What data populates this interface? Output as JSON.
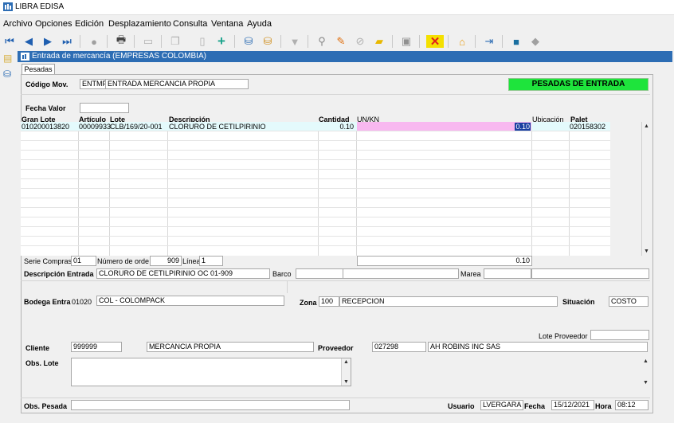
{
  "window": {
    "title": "LIBRA EDISA"
  },
  "menu": [
    "Archivo",
    "Opciones",
    "Edición",
    "Desplazamiento",
    "Consulta",
    "Ventana",
    "Ayuda"
  ],
  "form": {
    "title": "Entrada de mercancía (EMPRESAS COLOMBIA)",
    "tab": "Pesadas"
  },
  "header": {
    "codigo_mov_label": "Código Mov.",
    "codigo_mov_code": "ENTMP",
    "codigo_mov_desc": "ENTRADA MERCANCIA PROPIA",
    "banner": "PESADAS DE ENTRADA",
    "fecha_valor_label": "Fecha Valor",
    "fecha_valor": ""
  },
  "grid": {
    "columns": {
      "gran_lote": "Gran Lote",
      "articulo": "Artículo",
      "lote": "Lote",
      "descripcion": "Descripción",
      "cantidad": "Cantidad",
      "unkn": "UN/KN",
      "ubicacion": "Ubicación",
      "palet": "Palet"
    },
    "rows": [
      {
        "gran_lote": "010200013820",
        "articulo": "00009933",
        "lote": "CLB/169/20-001",
        "descripcion": "CLORURO DE CETILPIRINIO",
        "cantidad": "0.10",
        "unkn": "0.10",
        "ubicacion": "",
        "palet": "020158302"
      }
    ]
  },
  "detail": {
    "serie_compras_label": "Serie Compras",
    "serie_compras": "01",
    "numero_orden_label": "Número de orde",
    "numero_orden": "909",
    "linea_label": "Línea",
    "linea": "1",
    "total": "0.10",
    "descripcion_entrada_label": "Descripción Entrada",
    "descripcion_entrada": "CLORURO DE CETILPIRINIO OC 01-909",
    "barco_label": "Barco",
    "barco": "",
    "barco2": "",
    "marea_label": "Marea",
    "marea": "",
    "marea2": "",
    "bodega_label": "Bodega Entra",
    "bodega_code": "01020",
    "bodega_desc": "COL - COLOMPACK",
    "zona_label": "Zona",
    "zona_code": "100",
    "zona_desc": "RECEPCION",
    "situacion_label": "Situación",
    "situacion": "COSTO",
    "lote_proveedor_label": "Lote Proveedor",
    "lote_proveedor": "",
    "cliente_label": "Cliente",
    "cliente_code": "999999",
    "cliente_desc": "MERCANCIA PROPIA",
    "proveedor_label": "Proveedor",
    "proveedor_code": "027298",
    "proveedor_desc": "AH ROBINS INC SAS",
    "obs_lote_label": "Obs. Lote",
    "obs_lote": "",
    "obs_pesada_label": "Obs. Pesada",
    "obs_pesada": "",
    "usuario_label": "Usuario",
    "usuario": "LVERGARA",
    "fecha_label": "Fecha",
    "fecha": "15/12/2021",
    "hora_label": "Hora",
    "hora": "08:12"
  }
}
